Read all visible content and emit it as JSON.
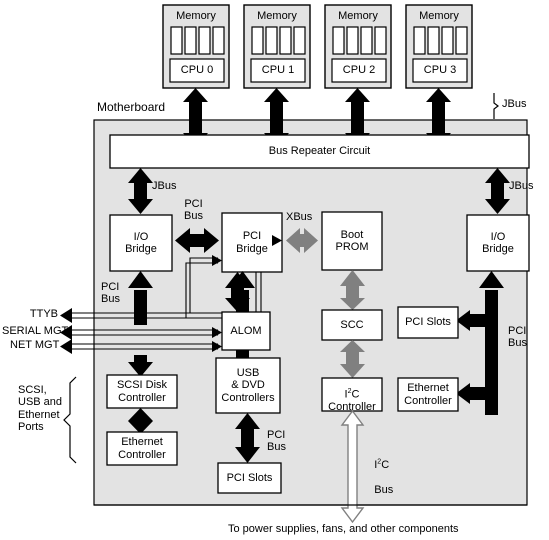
{
  "diagram": {
    "title": "Motherboard system block diagram",
    "colors": {
      "motherboard_fill": "#e3e3e3",
      "box_fill": "#ffffff",
      "module_fill": "#e3e3e3",
      "stroke": "#000000",
      "arrow_black": "#000000",
      "arrow_gray": "#808080",
      "arrow_white": "#ffffff",
      "background": "#ffffff"
    },
    "labels": {
      "motherboard": "Motherboard",
      "jbus_top": "JBus",
      "jbus_left": "JBus",
      "jbus_right": "JBus",
      "pci_bus_top": "PCI\nBus",
      "pci_bus_left": "PCI\nBus",
      "pci_bus_bottom_mid": "PCI\nBus",
      "pci_bus_right": "PCI\nBus",
      "xbus": "XBus",
      "i2c_bus": "I2C\nBus",
      "i2c_bus_super": "2",
      "i2c_bus_pre": "I",
      "i2c_bus_post": "C",
      "i2c_bus_second_line": "Bus",
      "ttyb": "TTYB",
      "serial_mgt": "SERIAL MGT",
      "net_mgt": "NET MGT",
      "ports_group": "SCSI,\nUSB and\nEthernet\nPorts",
      "footer": "To power supplies, fans, and other components"
    },
    "cpu_modules": [
      {
        "memory_label": "Memory",
        "cpu_label": "CPU 0",
        "dimm_count": 4
      },
      {
        "memory_label": "Memory",
        "cpu_label": "CPU 1",
        "dimm_count": 4
      },
      {
        "memory_label": "Memory",
        "cpu_label": "CPU 2",
        "dimm_count": 4
      },
      {
        "memory_label": "Memory",
        "cpu_label": "CPU 3",
        "dimm_count": 4
      }
    ],
    "boxes": {
      "bus_repeater": "Bus  Repeater  Circuit",
      "io_bridge_left": "I/O\nBridge",
      "pci_bridge": "PCI\nBridge",
      "boot_prom": "Boot\nPROM",
      "io_bridge_right": "I/O\nBridge",
      "alom": "ALOM",
      "scc": "SCC",
      "pci_slots_right": "PCI  Slots",
      "scsi_disk_controller": "SCSI Disk\nController",
      "usb_dvd_controllers": "USB\n& DVD\nControllers",
      "i2c_controller_pre": "I",
      "i2c_controller_sup": "2",
      "i2c_controller_post": "C",
      "i2c_controller_line2": "Controller",
      "ethernet_controller_right": "Ethernet\nController",
      "ethernet_controller_left": "Ethernet\nController",
      "pci_slots_bottom": "PCI  Slots"
    }
  }
}
